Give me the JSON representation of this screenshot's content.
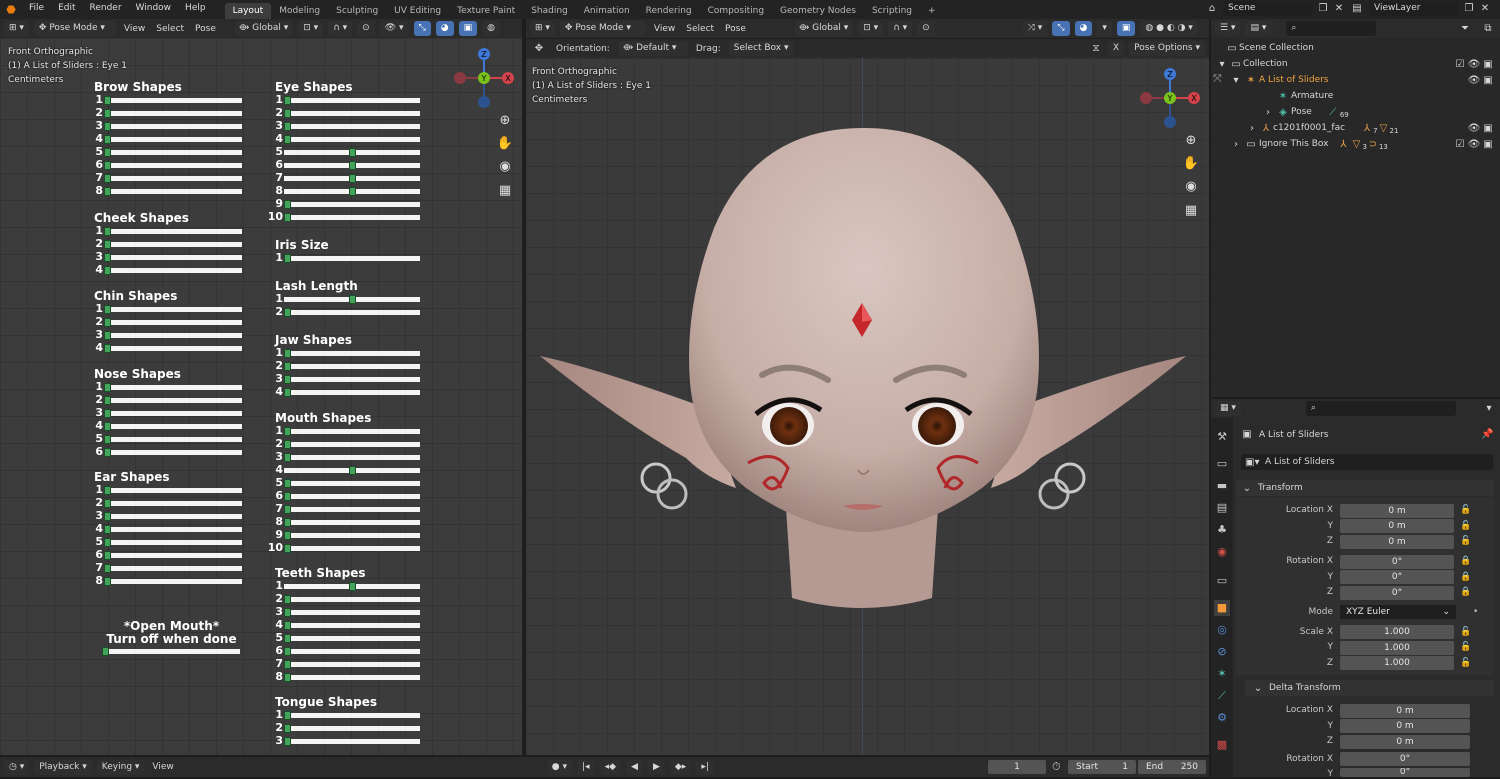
{
  "menus": [
    "File",
    "Edit",
    "Render",
    "Window",
    "Help"
  ],
  "workspaces": [
    "Layout",
    "Modeling",
    "Sculpting",
    "UV Editing",
    "Texture Paint",
    "Shading",
    "Animation",
    "Rendering",
    "Compositing",
    "Geometry Nodes",
    "Scripting"
  ],
  "scene": {
    "label": "Scene",
    "view_layer": "ViewLayer"
  },
  "left_view": {
    "mode": "Pose Mode",
    "menus": [
      "View",
      "Select",
      "Pose"
    ],
    "transform": "Global",
    "overlay": [
      "Front Orthographic",
      "(1) A List of Sliders : Eye 1",
      "Centimeters"
    ]
  },
  "right_view": {
    "mode": "Pose Mode",
    "menus": [
      "View",
      "Select",
      "Pose"
    ],
    "transform": "Global",
    "orientation_label": "Orientation:",
    "orientation_value": "Default",
    "drag_label": "Drag:",
    "drag_value": "Select Box",
    "pose_options": "Pose Options",
    "overlay": [
      "Front Orthographic",
      "(1) A List of Sliders : Eye 1",
      "Centimeters"
    ]
  },
  "gizmo": {
    "z": "Z",
    "y": "Y",
    "x": "X"
  },
  "slider_sections": [
    {
      "title": "Brow Shapes",
      "values": [
        0,
        0,
        0,
        0,
        0,
        0,
        0,
        0
      ]
    },
    {
      "title": "Cheek Shapes",
      "values": [
        0,
        0,
        0,
        0
      ]
    },
    {
      "title": "Chin Shapes",
      "values": [
        0,
        0,
        0,
        0
      ]
    },
    {
      "title": "Nose Shapes",
      "values": [
        0,
        0,
        0,
        0,
        0,
        0
      ]
    },
    {
      "title": "Ear Shapes",
      "values": [
        0,
        0,
        0,
        0,
        0,
        0,
        0,
        0
      ]
    },
    {
      "title": "Eye Shapes",
      "values": [
        0,
        0,
        0,
        0,
        0.5,
        0.5,
        0.5,
        0.5,
        0,
        0
      ]
    },
    {
      "title": "Iris Size",
      "values": [
        0
      ]
    },
    {
      "title": "Lash Length",
      "values": [
        0.5,
        0
      ]
    },
    {
      "title": "Jaw Shapes",
      "values": [
        0,
        0,
        0,
        0
      ]
    },
    {
      "title": "Mouth Shapes",
      "values": [
        0,
        0,
        0,
        0.5,
        0,
        0,
        0,
        0,
        0,
        0
      ]
    },
    {
      "title": "Teeth Shapes",
      "values": [
        0.5,
        0,
        0,
        0,
        0,
        0,
        0,
        0
      ]
    },
    {
      "title": "Tongue Shapes",
      "values": [
        0,
        0,
        0
      ]
    }
  ],
  "open_mouth": {
    "line1": "*Open Mouth*",
    "line2": "Turn off when done",
    "value": 0
  },
  "outliner": {
    "rows": [
      {
        "label": "Scene Collection"
      },
      {
        "label": "Collection"
      },
      {
        "label": "A List of Sliders"
      },
      {
        "label": "Armature"
      },
      {
        "label": "Pose",
        "badge": "69"
      },
      {
        "label": "c1201f0001_fac",
        "badge": "7",
        "badge2": "21"
      },
      {
        "label": "Ignore This Box",
        "badge": "3",
        "badge2": "13"
      }
    ]
  },
  "properties": {
    "object_title": "A List of Sliders",
    "object_name": "A List of Sliders",
    "transform_title": "Transform",
    "location": {
      "x": "0 m",
      "y": "0 m",
      "z": "0 m"
    },
    "rotation": {
      "x": "0°",
      "y": "0°",
      "z": "0°"
    },
    "mode_label": "Mode",
    "mode_value": "XYZ Euler",
    "scale": {
      "x": "1.000",
      "y": "1.000",
      "z": "1.000"
    },
    "delta_title": "Delta Transform",
    "delta_location": {
      "x": "0 m",
      "y": "0 m",
      "z": "0 m"
    },
    "delta_rotation": {
      "x": "0°",
      "y": "0°"
    },
    "labels": {
      "lx": "Location X",
      "y": "Y",
      "z": "Z",
      "rx": "Rotation X",
      "sx": "Scale X"
    }
  },
  "timeline": {
    "menus": [
      "Playback",
      "Keying",
      "View"
    ],
    "current_frame": "1",
    "start_label": "Start",
    "start": "1",
    "end_label": "End",
    "end": "250"
  }
}
